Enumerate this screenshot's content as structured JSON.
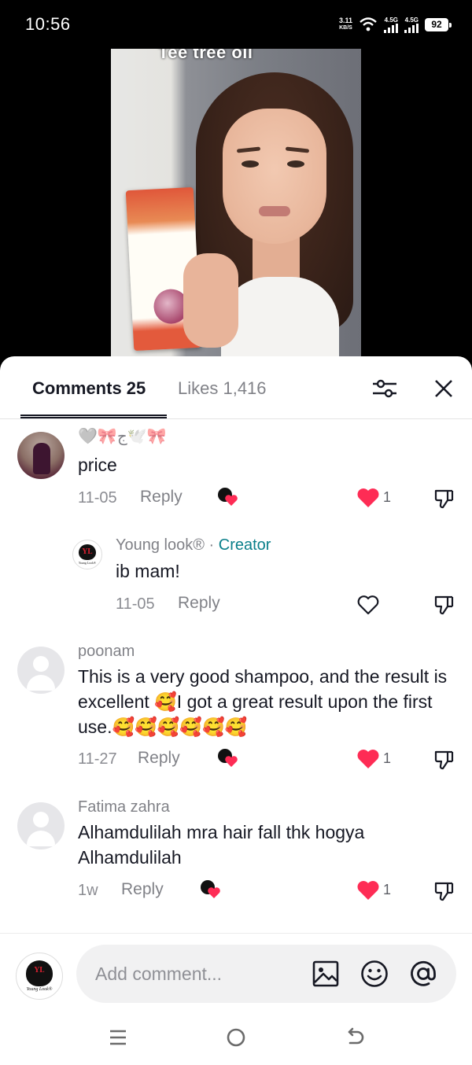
{
  "status_bar": {
    "time": "10:56",
    "speed_value": "3.11",
    "speed_unit": "KB/S",
    "network1": "4.5G",
    "network2": "4.5G",
    "battery": "92"
  },
  "video": {
    "caption": "Tee tree oil"
  },
  "sheet": {
    "tab_comments": "Comments 25",
    "tab_likes": "Likes 1,416"
  },
  "comments": [
    {
      "username": "🩶🎀ج🕊️🎀",
      "text": "price",
      "date": "11-05",
      "reply_label": "Reply",
      "likes": "1",
      "liked": true
    },
    {
      "username": "Young look®",
      "separator": " · ",
      "creator_label": "Creator",
      "text": "ib mam!",
      "date": "11-05",
      "reply_label": "Reply",
      "likes": "",
      "liked": false,
      "logo_text": "Young Look®"
    },
    {
      "username": "poonam",
      "text": "This is a very good shampoo, and the result is excellent 🥰I got a great result upon the first use.🥰🥰🥰🥰🥰🥰",
      "date": "11-27",
      "reply_label": "Reply",
      "likes": "1",
      "liked": true
    },
    {
      "username": "Fatima zahra",
      "text": "Alhamdulilah mra hair fall thk hogya Alhamdulilah",
      "date": "1w",
      "reply_label": "Reply",
      "likes": "1",
      "liked": true
    }
  ],
  "composer": {
    "placeholder": "Add comment...",
    "logo_text": "Young Look®"
  },
  "colors": {
    "like_red": "#fe2c55",
    "creator_teal": "#0a7f8a",
    "text_primary": "#161823"
  }
}
